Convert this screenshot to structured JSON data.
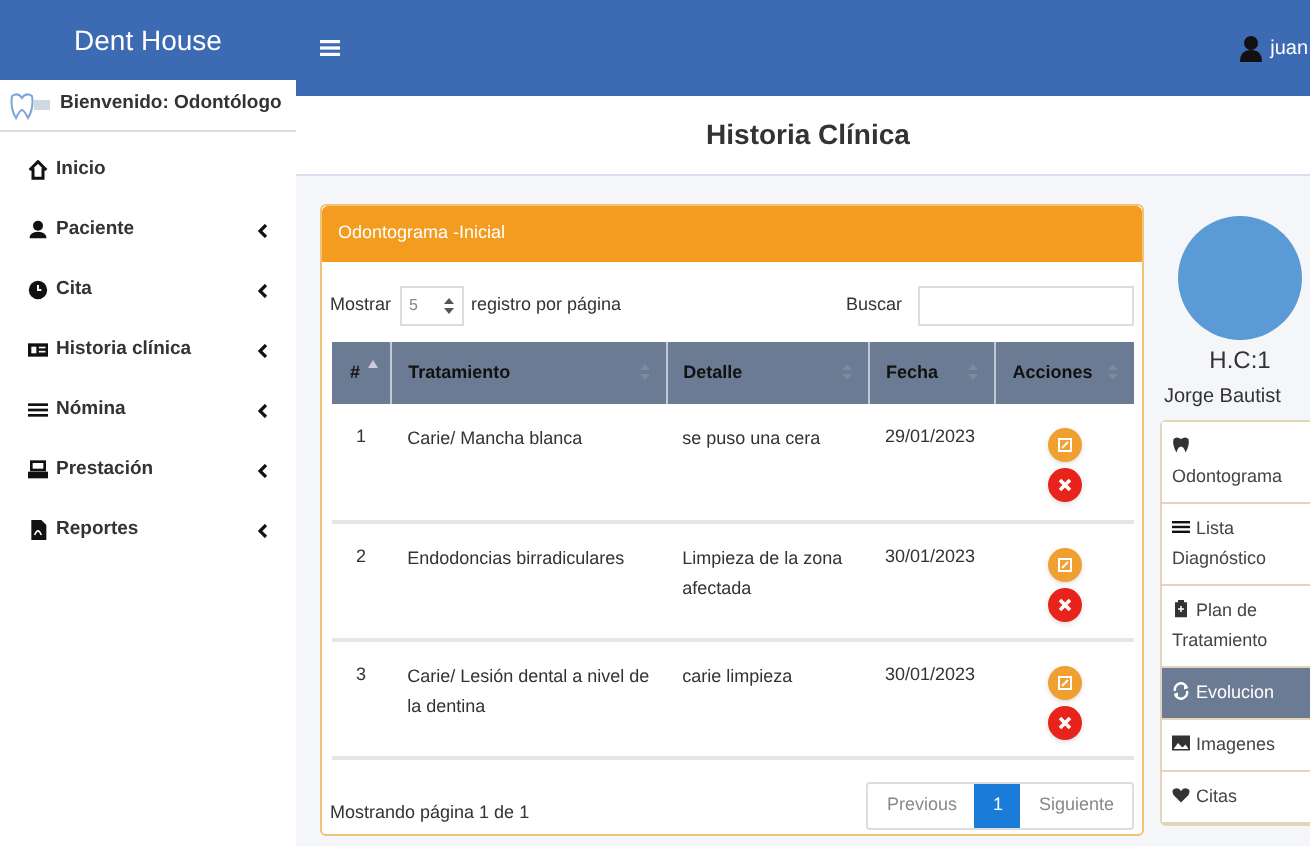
{
  "sidebar": {
    "brand": "Dent House",
    "welcome": "Bienvenido: Odontólogo",
    "items": [
      {
        "kind": "home",
        "label": "Inicio",
        "has_submenu": false
      },
      {
        "kind": "user",
        "label": "Paciente",
        "has_submenu": true
      },
      {
        "kind": "clock",
        "label": "Cita",
        "has_submenu": true
      },
      {
        "kind": "card",
        "label": "Historia clínica",
        "has_submenu": true
      },
      {
        "kind": "list",
        "label": "Nómina",
        "has_submenu": true
      },
      {
        "kind": "service",
        "label": "Prestación",
        "has_submenu": true
      },
      {
        "kind": "file",
        "label": "Reportes",
        "has_submenu": true
      }
    ]
  },
  "topbar": {
    "user": "juan"
  },
  "page_title": "Historia Clínica",
  "card": {
    "title": "Odontograma -Inicial",
    "length_label": "Mostrar",
    "length_value": "5",
    "length_suffix": "registro por página",
    "search_label": "Buscar",
    "columns": [
      {
        "label": "#",
        "sorted": true
      },
      {
        "label": "Tratamiento",
        "sorted": false
      },
      {
        "label": "Detalle",
        "sorted": false
      },
      {
        "label": "Fecha",
        "sorted": false
      },
      {
        "label": "Acciones",
        "sorted": false
      }
    ],
    "rows": [
      {
        "number": "1",
        "treatment": "Carie/ Mancha blanca",
        "detail": "se puso una cera",
        "date": "29/01/2023"
      },
      {
        "number": "2",
        "treatment": "Endodoncias birradiculares",
        "detail": "Limpieza de la zona afectada",
        "date": "30/01/2023"
      },
      {
        "number": "3",
        "treatment": "Carie/ Lesión dental a nivel de la dentina",
        "detail": "carie limpieza",
        "date": "30/01/2023"
      }
    ],
    "info": "Mostrando página 1 de 1",
    "pagination": {
      "previous": "Previous",
      "pages": [
        {
          "label": "1",
          "selected": true
        }
      ],
      "next": "Siguiente"
    }
  },
  "patient": {
    "hc": "H.C:1",
    "name": "Jorge Bautist",
    "menu": [
      {
        "kind": "tooth",
        "label": "Odontograma",
        "selected": false
      },
      {
        "kind": "list",
        "label": "Lista Diagnóstico",
        "selected": false
      },
      {
        "kind": "clipboard",
        "label": "Plan de Tratamiento",
        "selected": false
      },
      {
        "kind": "sync",
        "label": "Evolucion",
        "selected": true
      },
      {
        "kind": "image",
        "label": "Imagenes",
        "selected": false
      },
      {
        "kind": "heart",
        "label": "Citas",
        "selected": false
      }
    ]
  }
}
